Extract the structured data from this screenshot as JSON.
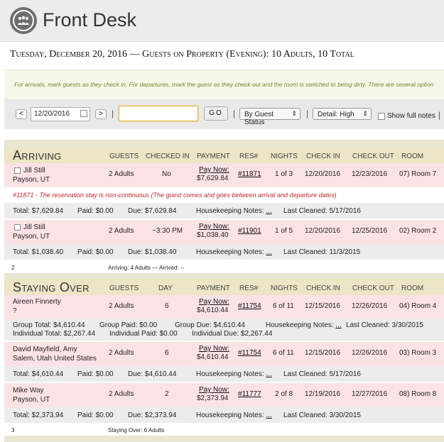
{
  "app": {
    "title": "Front Desk"
  },
  "dateline": "Tuesday, December 20, 2016 — Guests on Property (Evening): 10 Adults, 10 Total",
  "info_text": "For arrivals, mark guests as they check in. For departures, mark the guest as they check out and the room is switched to being dirty. There are several option",
  "toolbar": {
    "prev": "<",
    "date_value": "12/20/2016",
    "next": ">",
    "sep1": "|",
    "search_value": "",
    "go": "GO",
    "sep2": "|",
    "sort_select": "By Guest Status",
    "sep3": "|",
    "detail_select": "Detail: High",
    "show_notes": "Show full notes",
    "sep4": "|"
  },
  "arriving": {
    "title": "Arriving",
    "headers": [
      "GUESTS",
      "CHECKED IN",
      "PAYMENT",
      "RES#",
      "NIGHTS",
      "CHECK IN",
      "CHECK OUT",
      "ROOM"
    ],
    "rows": [
      {
        "name": "Jill Still",
        "loc": "Payson, UT",
        "guests": "2 Adults",
        "checked": "No",
        "pay1": "Pay Now:",
        "pay2": "$7,629.84",
        "res": "#11871",
        "nights": "1 of 3",
        "in": "12/20/2016",
        "out": "12/23/2016",
        "room": "07) Room 7",
        "warning": "#11871 - The reservation stay is non-continuous (The guest comes and goes between arrival and departure dates)",
        "total": "Total: $7,629.84",
        "paid": "Paid: $0.00",
        "due": "Due: $7,629.84",
        "hk": "Housekeeping Notes:",
        "hk_link": "...",
        "cleaned": "Last Cleaned: 5/17/2016"
      },
      {
        "name": "Jill Still",
        "loc": "Payson, UT",
        "guests": "2 Adults",
        "checked": "~3:30 PM",
        "pay1": "Pay Now:",
        "pay2": "$1,038.40",
        "res": "#11901",
        "nights": "1 of 5",
        "in": "12/20/2016",
        "out": "12/25/2016",
        "room": "02) Room 2",
        "total": "Total: $1,038.40",
        "paid": "Paid: $0.00",
        "due": "Due: $1,038.40",
        "hk": "Housekeeping Notes:",
        "hk_link": "...",
        "cleaned": "Last Cleaned: 11/3/2015"
      }
    ],
    "footer_count": "2",
    "footer_label": "Arriving:",
    "footer_text": "4 Adults — Arrived: --"
  },
  "staying": {
    "title": "Staying Over",
    "headers": [
      "GUESTS",
      "DAY",
      "PAYMENT",
      "RES#",
      "NIGHTS",
      "CHECK IN",
      "CHECK OUT",
      "ROOM"
    ],
    "row1": {
      "name": "Aireen Finnerty",
      "loc": "?",
      "guests": "2 Adults",
      "day": "6",
      "pay1": "Pay Now:",
      "pay2": "$4,610.44",
      "res": "#11754",
      "nights": "6 of 11",
      "in": "12/15/2016",
      "out": "12/26/2016",
      "room": "04) Room 4",
      "g_total": "Group Total: $4,610.44",
      "g_paid": "Group Paid: $0.00",
      "g_due": "Group Due: $4,610.44",
      "hk": "Housekeeping Notes:",
      "hk_link": "...",
      "cleaned": "Last Cleaned: 3/30/2015",
      "i_total": "Individual Total: $2,267.44",
      "i_paid": "Individual Paid: $0.00",
      "i_due": "Individual Due: $2,267.44"
    },
    "row2": {
      "name": "David Mayfield, Amy",
      "loc": "Salem, Utah United States",
      "guests": "2 Adults",
      "day": "6",
      "pay1": "Pay Now:",
      "pay2": "$4,610.44",
      "res": "#11754",
      "nights": "6 of 11",
      "in": "12/15/2016",
      "out": "12/26/2016",
      "room": "03) Room 3",
      "total": "Total: $4,610.44",
      "paid": "Paid: $0.00",
      "due": "Due: $4,610.44",
      "hk": "Housekeeping Notes:",
      "hk_link": "...",
      "cleaned": "Last Cleaned: 5/17/2016"
    },
    "row3": {
      "name": "Mike Way",
      "loc": "Payson, UT",
      "guests": "2 Adults",
      "day": "2",
      "pay1": "Pay Now:",
      "pay2": "$2,373.94",
      "res": "#11777",
      "nights": "2 of 8",
      "in": "12/19/2016",
      "out": "12/27/2016",
      "room": "08) Room 8",
      "total": "Total: $2,373.94",
      "paid": "Paid: $0.00",
      "due": "Due: $2,373.94",
      "hk": "Housekeeping Notes:",
      "hk_link": "...",
      "cleaned": "Last Cleaned: 3/30/2015"
    },
    "footer_count": "3",
    "footer_label": "Staying Over:",
    "footer_text": "6 Adults"
  }
}
